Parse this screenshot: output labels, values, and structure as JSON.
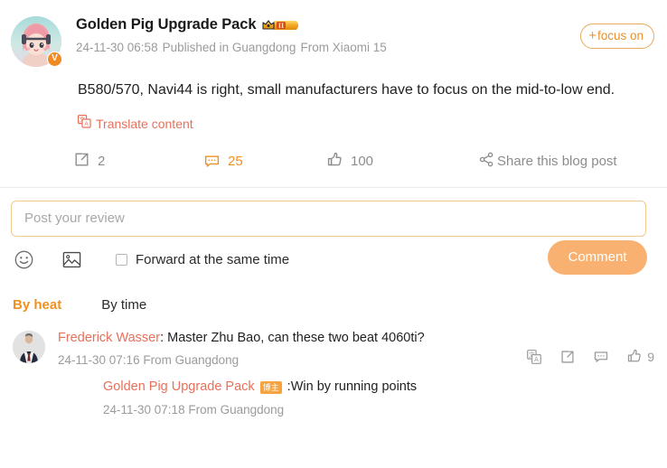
{
  "post": {
    "author": {
      "name": "Golden Pig Upgrade Pack",
      "level_badge_text": "II",
      "verified_mark": "V",
      "avatar_icon": "anime-girl-avatar"
    },
    "meta": {
      "date": "24-11-30 06:58",
      "published_in": "Published in Guangdong",
      "device": "From Xiaomi 15"
    },
    "follow_button": {
      "plus": "+",
      "label": "focus on"
    },
    "content": "B580/570, Navi44 is right, small manufacturers have to focus on the mid-to-low end.",
    "translate_label": "Translate content",
    "actions": {
      "repost_count": "2",
      "comment_count": "25",
      "like_count": "100",
      "share_label": "Share this blog post"
    }
  },
  "review_box": {
    "placeholder": "Post your review",
    "value": "",
    "forward_label": "Forward at the same time",
    "forward_checked": false,
    "submit_label": "Comment"
  },
  "sort": {
    "tabs": [
      {
        "label": "By heat",
        "active": true
      },
      {
        "label": "By time",
        "active": false
      }
    ]
  },
  "comments": [
    {
      "author": "Frederick Wasser",
      "separator": ": ",
      "text": "Master Zhu Bao, can these two beat 4060ti?",
      "time": "24-11-30 07:16 From Guangdong",
      "like_count": "9",
      "avatar_icon": "man-in-suit-avatar",
      "reply": {
        "author": "Golden Pig Upgrade Pack",
        "badge": "博主",
        "separator": ": ",
        "text": "Win by running points",
        "time": "24-11-30 07:18 From Guangdong"
      }
    }
  ],
  "colors": {
    "accent_orange": "#f09020",
    "link_salmon": "#e8705a",
    "muted_gray": "#9b9b9b",
    "button_orange": "#f8b170",
    "badge_orange": "#f6a340"
  }
}
